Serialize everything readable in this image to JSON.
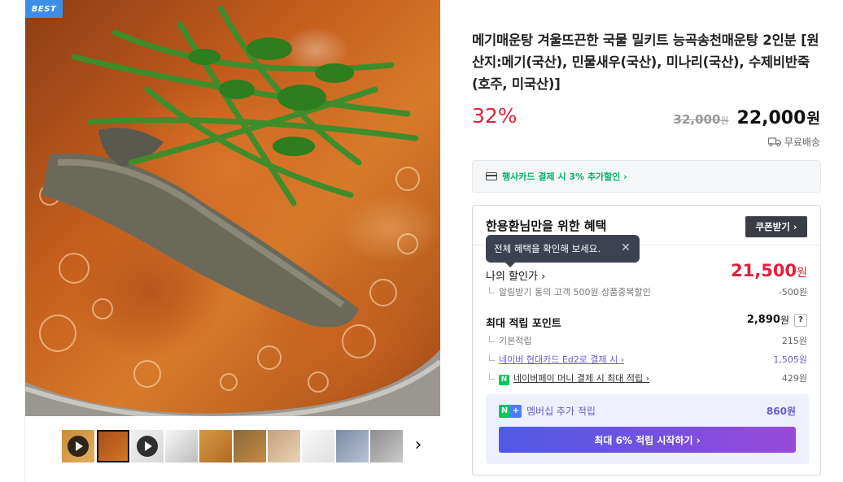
{
  "badge": {
    "best": "BEST"
  },
  "product": {
    "title": "메기매운탕 겨울뜨끈한 국물 밀키트 능곡송천매운탕 2인분 [원산지:메기(국산), 민물새우(국산), 미나리(국산), 수제비반죽(호주, 미국산)]",
    "discount_rate": "32%",
    "original_price": "32,000",
    "original_won": "원",
    "final_price": "22,000",
    "final_won": "원",
    "shipping": "무료배송"
  },
  "card_promo": {
    "text": "행사카드 결제 시 3% 추가할인 ›"
  },
  "benefits": {
    "title": "한용환님만을 위한 혜택",
    "coupon_button": "쿠폰받기 ›",
    "tooltip": "전체 혜택을 확인해 보세요.",
    "tooltip_close": "✕",
    "my_discount_label": "나의 할인가 ›",
    "my_discount_price": "21,500",
    "my_discount_won": "원",
    "sub_discount": {
      "label": "알림받기 동의 고객 500원 상품중복할인",
      "value": "-500원"
    },
    "points_title": "최대 적립 포인트",
    "points_total": "2,890",
    "points_won": "원",
    "points_help": "?",
    "point_rows": [
      {
        "label": "기본적립",
        "value": "215원"
      },
      {
        "label": "네이버 현대카드 Ed2로 결제 시 ›",
        "value": "1,505원"
      },
      {
        "label": "네이버페이 머니 결제 시 최대 적립 ›",
        "value": "429원"
      }
    ],
    "npay_mark": "N",
    "membership": {
      "badge_n": "N",
      "badge_plus": "+",
      "label": "멤버십 추가 적립",
      "value": "860원",
      "button": "최대 6% 적립 시작하기 ›"
    }
  },
  "thumbnails": {
    "count": 10,
    "selected_index": 1,
    "video_indices": [
      0,
      2
    ],
    "next_icon": "›"
  },
  "colors": {
    "discount_red": "#e0213b",
    "naver_green": "#03b26c",
    "membership_purple": "#6b5bd2",
    "badge_blue": "#3c8ee8"
  }
}
